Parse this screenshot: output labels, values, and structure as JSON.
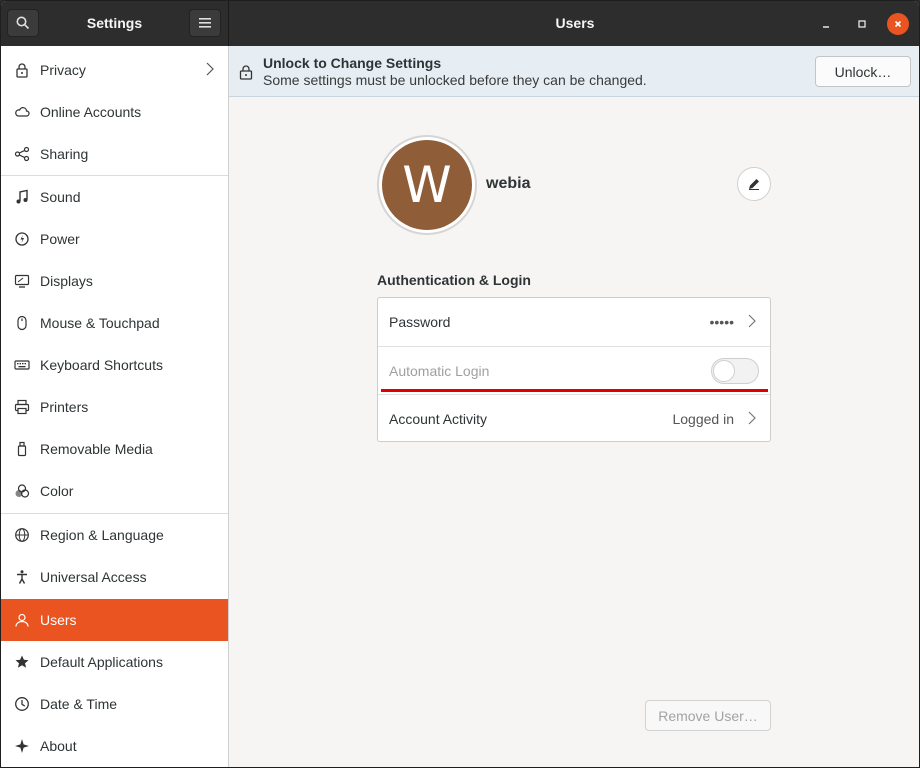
{
  "header": {
    "sidebar_title": "Settings",
    "window_title": "Users"
  },
  "sidebar": {
    "items": [
      {
        "label": "Privacy",
        "icon": "lock-icon"
      },
      {
        "label": "Online Accounts",
        "icon": "cloud-icon"
      },
      {
        "label": "Sharing",
        "icon": "share-icon"
      },
      {
        "label": "Sound",
        "icon": "music-note-icon"
      },
      {
        "label": "Power",
        "icon": "power-icon"
      },
      {
        "label": "Displays",
        "icon": "display-icon"
      },
      {
        "label": "Mouse & Touchpad",
        "icon": "mouse-icon"
      },
      {
        "label": "Keyboard Shortcuts",
        "icon": "keyboard-icon"
      },
      {
        "label": "Printers",
        "icon": "printer-icon"
      },
      {
        "label": "Removable Media",
        "icon": "usb-drive-icon"
      },
      {
        "label": "Color",
        "icon": "color-icon"
      },
      {
        "label": "Region & Language",
        "icon": "globe-icon"
      },
      {
        "label": "Universal Access",
        "icon": "accessibility-icon"
      },
      {
        "label": "Users",
        "icon": "users-icon",
        "active": true
      },
      {
        "label": "Default Applications",
        "icon": "star-icon"
      },
      {
        "label": "Date & Time",
        "icon": "clock-icon"
      },
      {
        "label": "About",
        "icon": "sparkle-icon"
      }
    ]
  },
  "infobar": {
    "title": "Unlock to Change Settings",
    "subtitle": "Some settings must be unlocked before they can be changed.",
    "unlock_label": "Unlock…"
  },
  "user": {
    "avatar_initial": "W",
    "avatar_color": "#8f5e38",
    "name": "webia"
  },
  "auth": {
    "title": "Authentication & Login",
    "rows": [
      {
        "label": "Password",
        "value": "•••••"
      },
      {
        "label": "Automatic Login",
        "toggle": false
      },
      {
        "label": "Account Activity",
        "value": "Logged in"
      }
    ]
  },
  "remove_user_label": "Remove User…",
  "colors": {
    "accent": "#e95420",
    "headerbar": "#2d2d2d",
    "annotation_line": "#e00000"
  }
}
